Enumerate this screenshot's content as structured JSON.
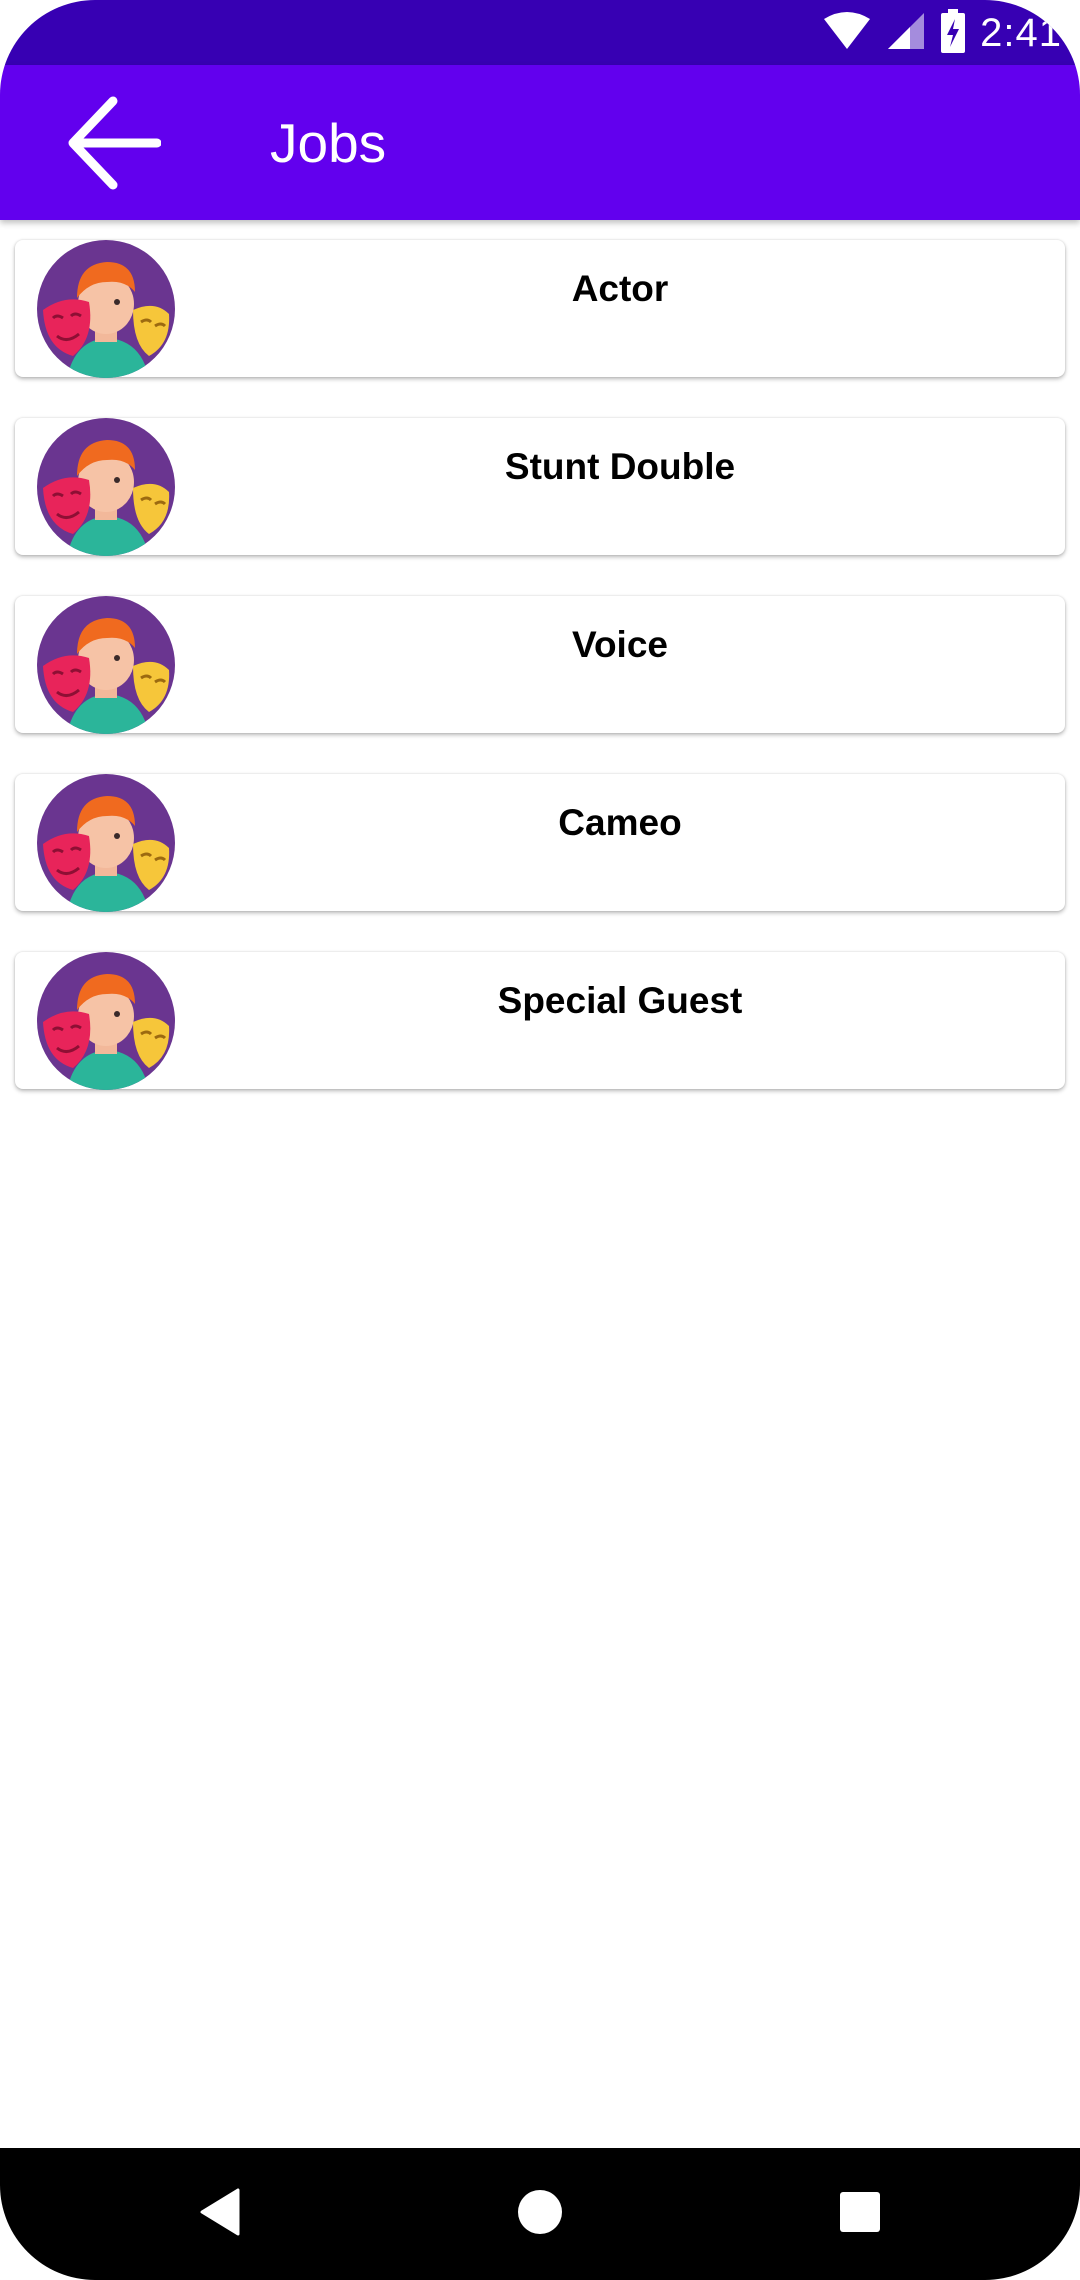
{
  "status_bar": {
    "time": "2:41",
    "icons": [
      "wifi-icon",
      "cellular-signal-icon",
      "battery-charging-icon"
    ]
  },
  "app_bar": {
    "title": "Jobs",
    "back_icon": "arrow-back-icon",
    "color": "#6200ee",
    "status_color": "#3700b3"
  },
  "jobs": [
    {
      "label": "Actor",
      "icon": "theater-masks-avatar-icon"
    },
    {
      "label": "Stunt Double",
      "icon": "theater-masks-avatar-icon"
    },
    {
      "label": "Voice",
      "icon": "theater-masks-avatar-icon"
    },
    {
      "label": "Cameo",
      "icon": "theater-masks-avatar-icon"
    },
    {
      "label": "Special Guest",
      "icon": "theater-masks-avatar-icon"
    }
  ],
  "nav_bar": {
    "buttons": [
      "nav-back-icon",
      "nav-home-icon",
      "nav-recents-icon"
    ]
  }
}
